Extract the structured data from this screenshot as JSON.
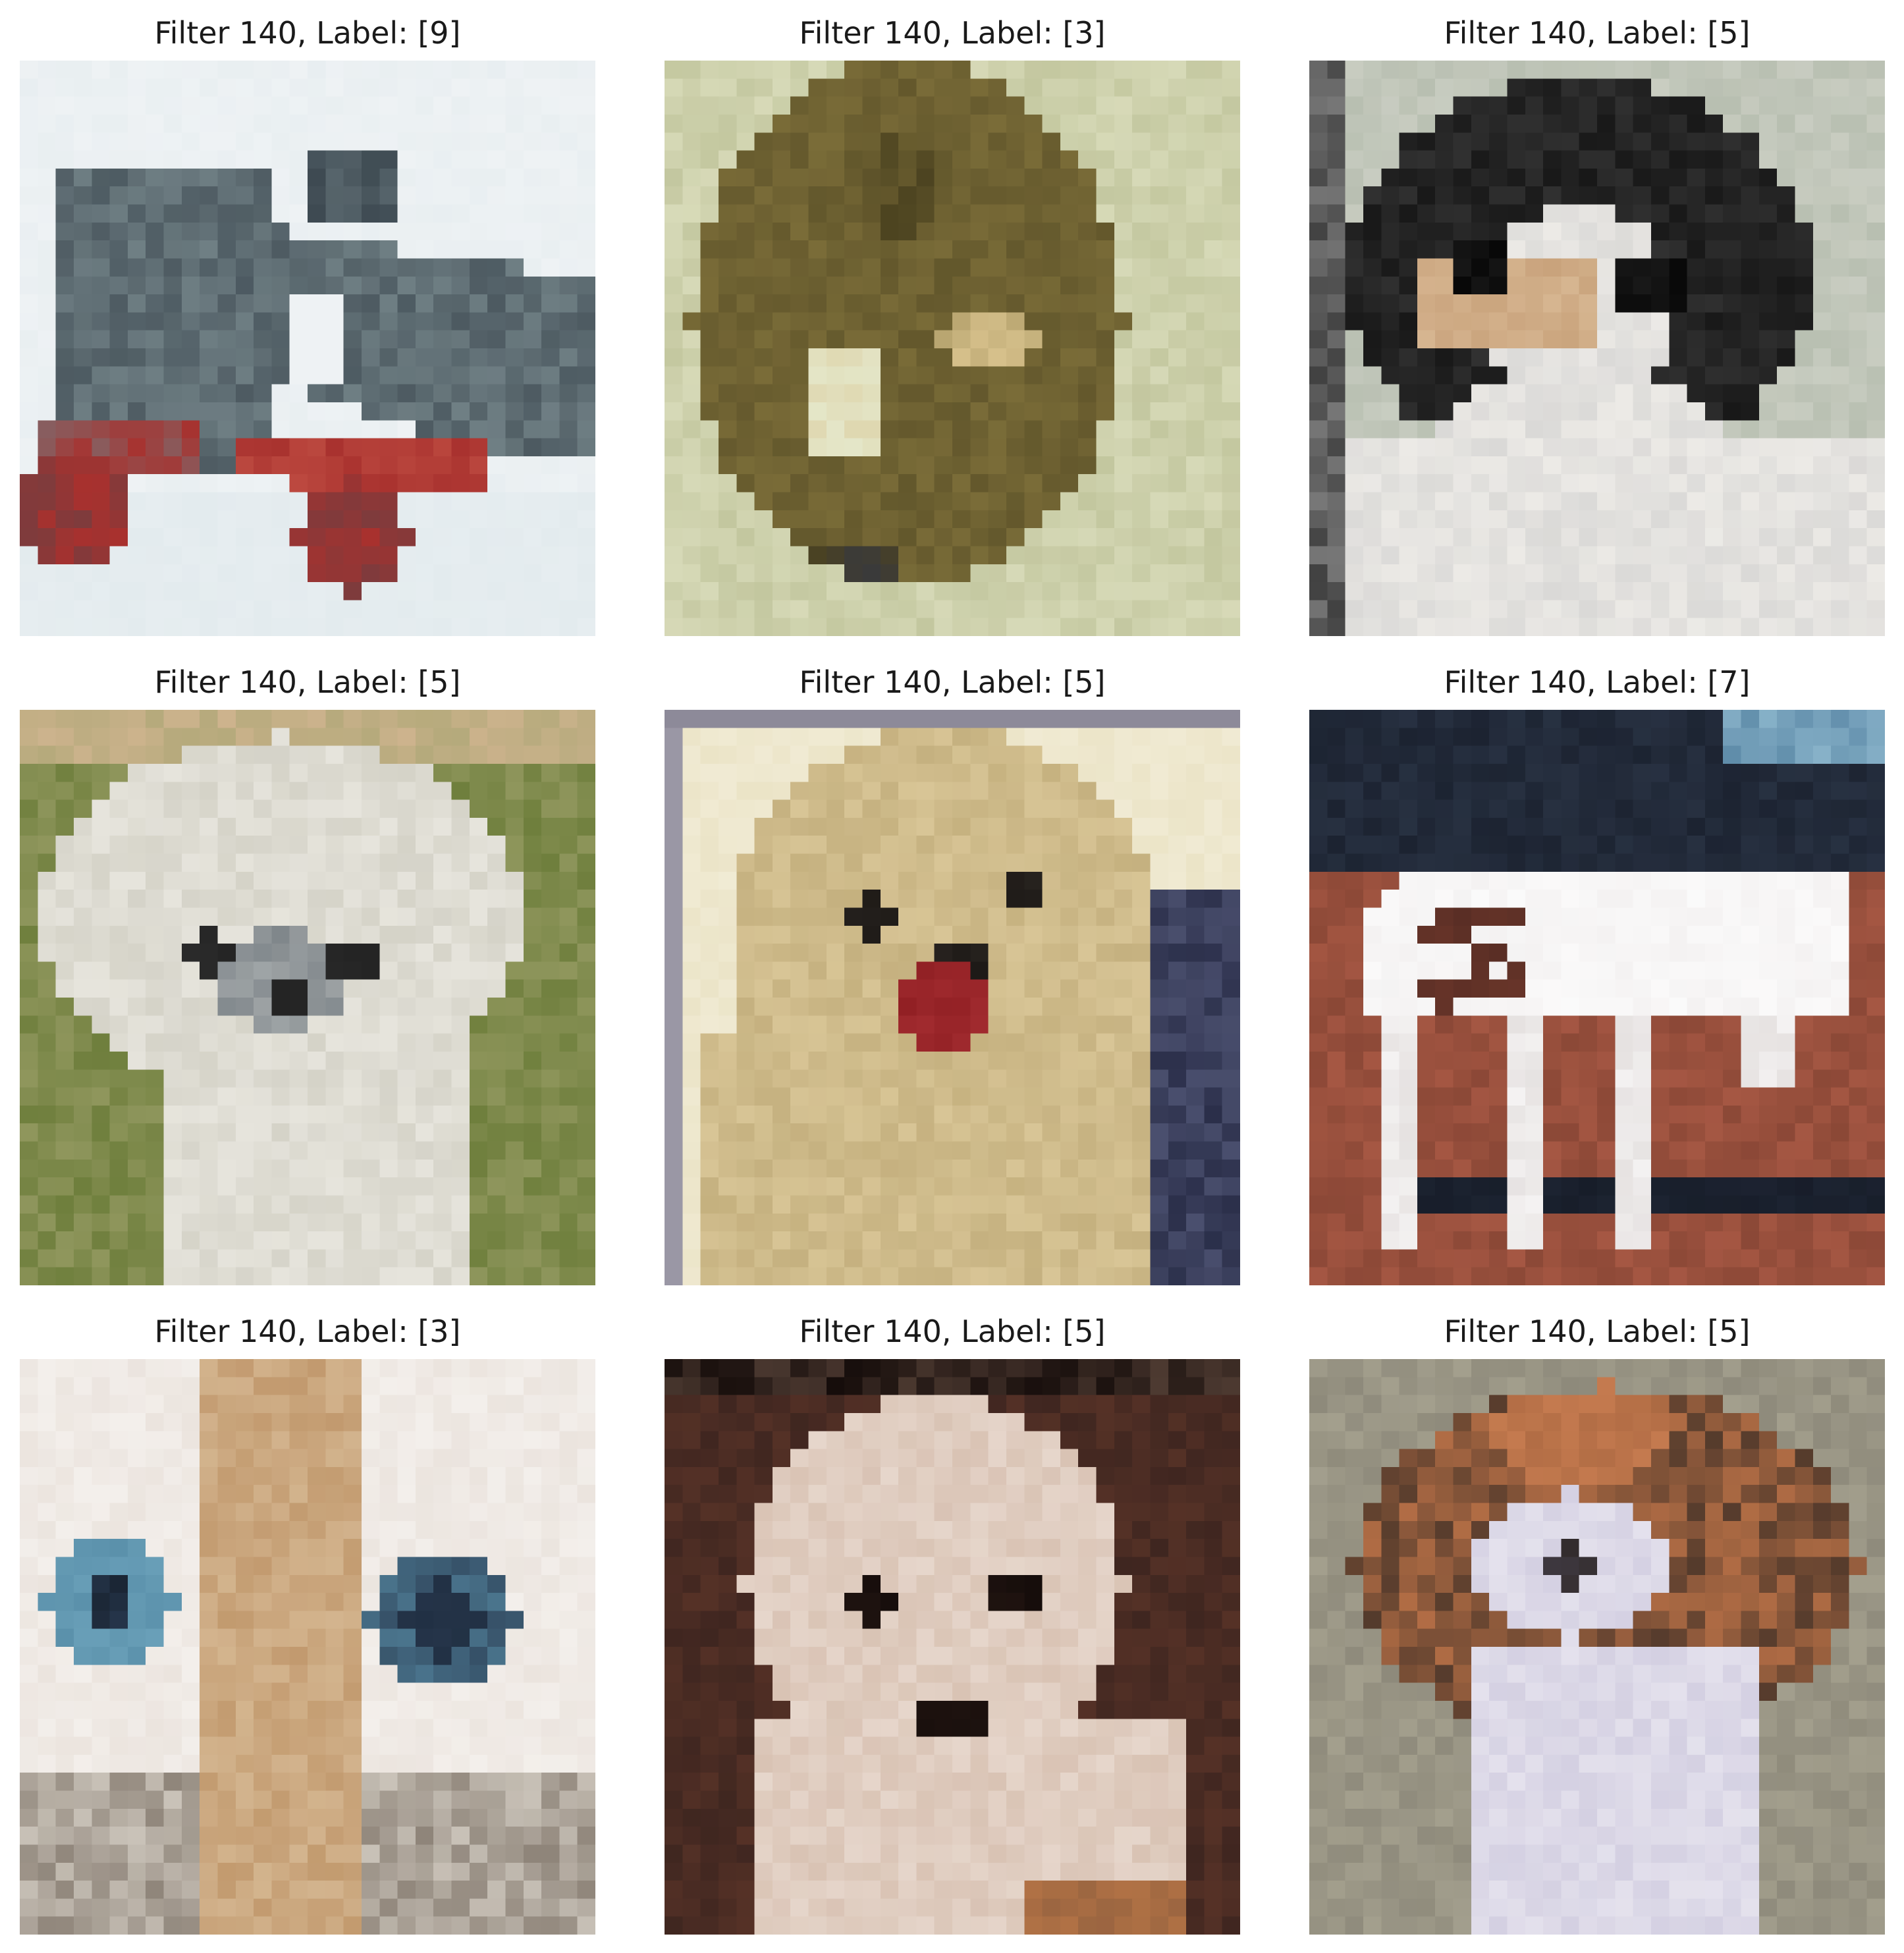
{
  "figure": {
    "panels": [
      {
        "title": "Filter 140, Label: [9]",
        "subject": "red-gray toy truck",
        "palette": {
          "bg": "#dbe6ea",
          "main": "#6f7f84",
          "dark": "#3e4a52",
          "accent": "#a8312e",
          "light": "#eef2f4"
        }
      },
      {
        "title": "Filter 140, Label: [3]",
        "subject": "olive-brown cat",
        "palette": {
          "bg": "#c3c79f",
          "main": "#7a6c38",
          "dark": "#4c4320",
          "accent": "#d7c18c",
          "light": "#e4e6c8"
        }
      },
      {
        "title": "Filter 140, Label: [5]",
        "subject": "black-and-white dog",
        "palette": {
          "bg": "#b8bfb1",
          "main": "#181818",
          "dark": "#070707",
          "accent": "#c9a37c",
          "light": "#eceae6"
        }
      },
      {
        "title": "Filter 140, Label: [5]",
        "subject": "white fluffy dog on grass",
        "palette": {
          "bg": "#6f7f3d",
          "main": "#d5d3c8",
          "dark": "#232323",
          "accent": "#9da06a",
          "light": "#f2f0ea"
        }
      },
      {
        "title": "Filter 140, Label: [5]",
        "subject": "cream puppy with red tongue",
        "palette": {
          "bg": "#ebe4c7",
          "main": "#d8c596",
          "dark": "#1e1a17",
          "accent": "#912024",
          "light": "#f4efdc"
        }
      },
      {
        "title": "Filter 140, Label: [7]",
        "subject": "white horse",
        "palette": {
          "bg": "#a55743",
          "main": "#f4f2f2",
          "dark": "#1c2331",
          "accent": "#7a3e2e",
          "light": "#ffffff"
        }
      },
      {
        "title": "Filter 140, Label: [3]",
        "subject": "cream cat with blue eyes",
        "palette": {
          "bg": "#ebe4de",
          "main": "#d3b48e",
          "dark": "#253449",
          "accent": "#5b91ab",
          "light": "#f7f4f1"
        }
      },
      {
        "title": "Filter 140, Label: [5]",
        "subject": "pale fluffy puppy",
        "palette": {
          "bg": "#3f2620",
          "main": "#d9c3b4",
          "dark": "#160d0b",
          "accent": "#996440",
          "light": "#efe3db"
        }
      },
      {
        "title": "Filter 140, Label: [5]",
        "subject": "brown-and-white spaniel",
        "palette": {
          "bg": "#8e8a7b",
          "main": "#b26d45",
          "dark": "#2c2521",
          "accent": "#d4d0e2",
          "light": "#efedf4"
        }
      }
    ]
  }
}
